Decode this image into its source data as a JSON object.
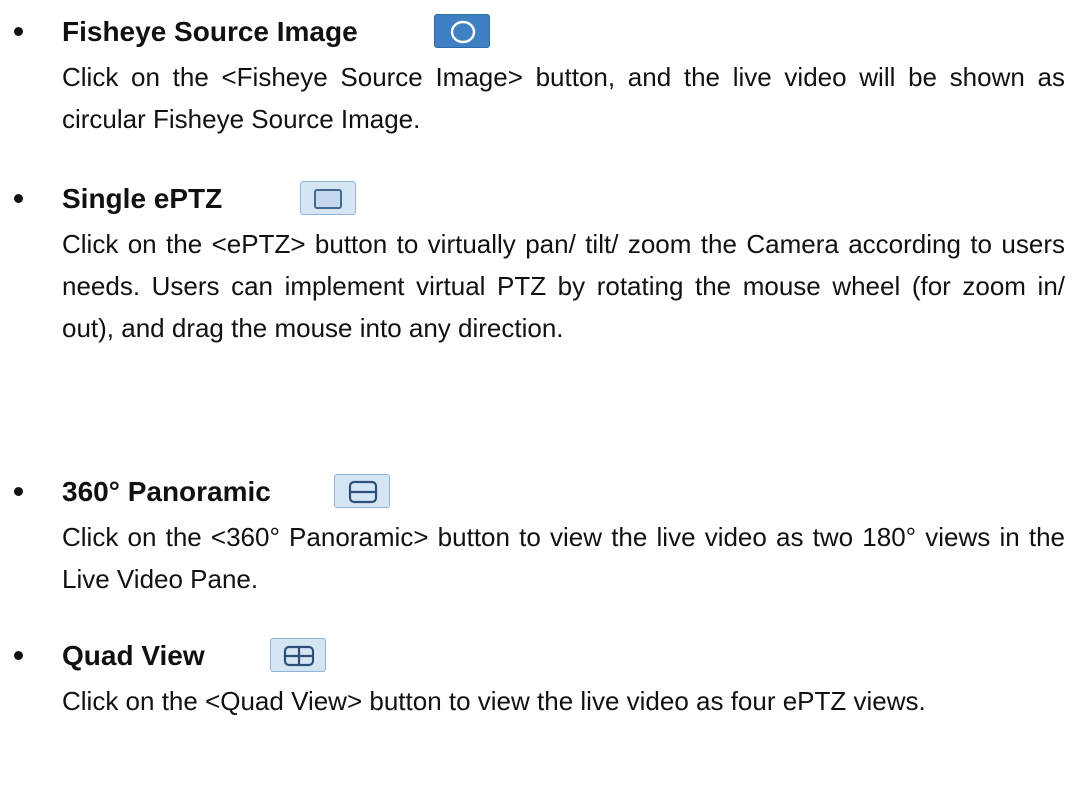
{
  "items": [
    {
      "title": "Fisheye Source Image",
      "icon": "circle-icon",
      "description": "Click on the <Fisheye Source Image> button, and the live video will be shown as circular Fisheye Source Image."
    },
    {
      "title": "Single ePTZ",
      "icon": "single-view-icon",
      "description": "Click on the <ePTZ> button to virtually pan/ tilt/ zoom the Camera according to users needs. Users can implement virtual PTZ by rotating the mouse wheel (for zoom in/ out), and drag the mouse into any direction."
    },
    {
      "title": "360° Panoramic",
      "icon": "panoramic-split-icon",
      "description": "Click on the <360° Panoramic> button to view the live video as two 180° views in the Live Video Pane."
    },
    {
      "title": "Quad View",
      "icon": "quad-grid-icon",
      "description": "Click on the <Quad View> button to view the live video as four ePTZ views."
    }
  ],
  "colors": {
    "icon_active_bg": "#3f7fc4",
    "icon_bg": "#cfe0f2",
    "icon_stroke": "#4a6d94"
  }
}
